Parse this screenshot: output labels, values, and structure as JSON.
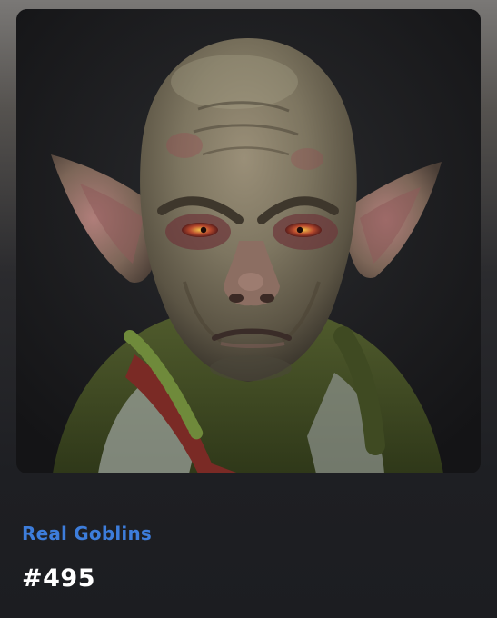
{
  "nft": {
    "image_subject": "goblin-portrait",
    "collection_name": "Real Goblins",
    "token_id": "#495"
  },
  "colors": {
    "collection_link": "#3d7ddb",
    "token_id": "#ffffff",
    "background": "#1c1d21"
  }
}
